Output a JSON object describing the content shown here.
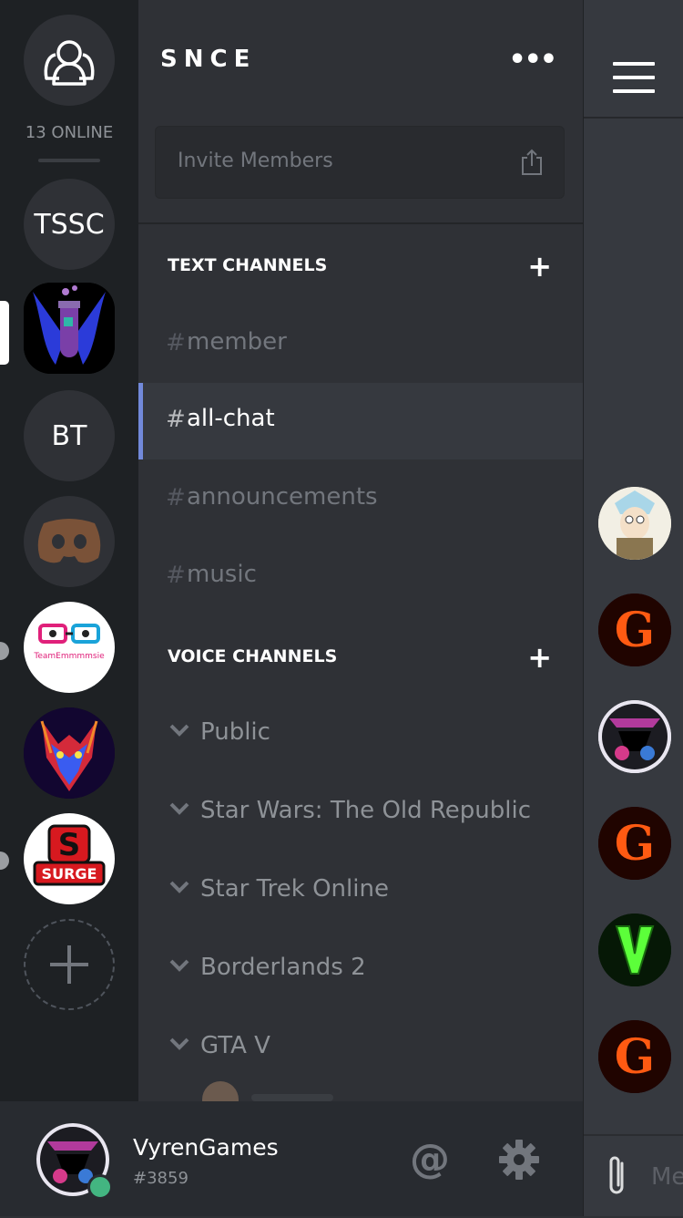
{
  "rail": {
    "online_count": "13 ONLINE",
    "servers": [
      {
        "label": "TSSC"
      },
      {
        "label": "BT"
      }
    ],
    "logo_text_team": "TeamEmmmmsie",
    "logo_text_surge": "SURGE"
  },
  "server": {
    "name": "SNCE",
    "more": "•••",
    "invite_placeholder": "Invite Members"
  },
  "text_channels": {
    "label": "TEXT CHANNELS",
    "add": "+",
    "items": [
      {
        "hash": "#",
        "name": "member"
      },
      {
        "hash": "#",
        "name": "all-chat"
      },
      {
        "hash": "#",
        "name": "announcements"
      },
      {
        "hash": "#",
        "name": "music"
      }
    ]
  },
  "voice_channels": {
    "label": "VOICE CHANNELS",
    "add": "+",
    "items": [
      {
        "name": "Public"
      },
      {
        "name": "Star Wars: The Old Republic"
      },
      {
        "name": "Star Trek Online"
      },
      {
        "name": "Borderlands 2"
      },
      {
        "name": "GTA V"
      }
    ]
  },
  "user": {
    "name": "VyrenGames",
    "tag": "#3859",
    "mention": "@"
  },
  "composer": {
    "placeholder": "Me"
  },
  "colors": {
    "accent": "#7289da",
    "online": "#43b581"
  }
}
